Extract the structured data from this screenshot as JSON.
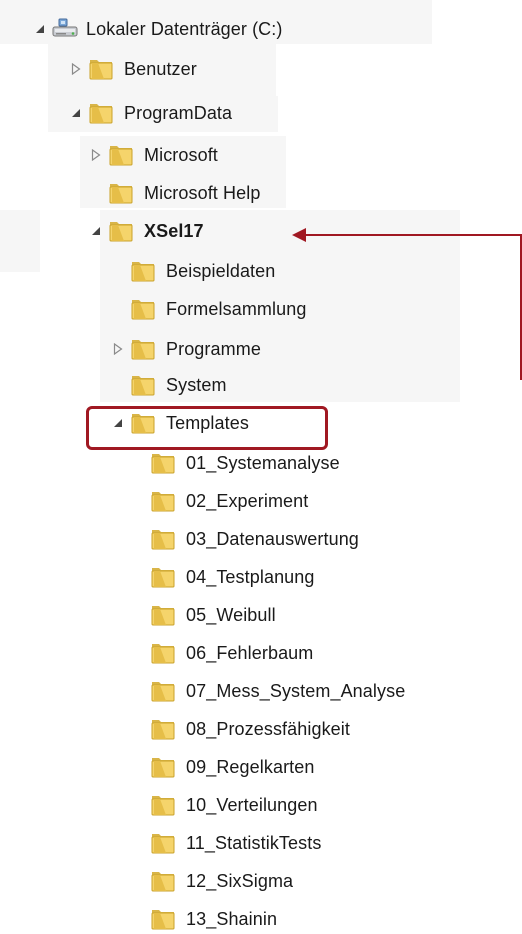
{
  "tree": {
    "root": {
      "label": "Lokaler Datenträger (C:)",
      "icon": "drive-icon",
      "toggle": "expanded"
    },
    "benutzer": {
      "label": "Benutzer",
      "toggle": "collapsed"
    },
    "programdata": {
      "label": "ProgramData",
      "toggle": "expanded"
    },
    "microsoft": {
      "label": "Microsoft",
      "toggle": "collapsed"
    },
    "microsoft_help": {
      "label": "Microsoft Help",
      "toggle": "none"
    },
    "xsel17": {
      "label": "XSel17",
      "toggle": "expanded"
    },
    "beispieldaten": {
      "label": "Beispieldaten",
      "toggle": "none"
    },
    "formelsammlung": {
      "label": "Formelsammlung",
      "toggle": "none"
    },
    "programme": {
      "label": "Programme",
      "toggle": "collapsed"
    },
    "system": {
      "label": "System",
      "toggle": "none"
    },
    "templates": {
      "label": "Templates",
      "toggle": "expanded"
    },
    "template_items": [
      "01_Systemanalyse",
      "02_Experiment",
      "03_Datenauswertung",
      "04_Testplanung",
      "05_Weibull",
      "06_Fehlerbaum",
      "07_Mess_System_Analyse",
      "08_Prozessfähigkeit",
      "09_Regelkarten",
      "10_Verteilungen",
      "11_StatistikTests",
      "12_SixSigma",
      "13_Shainin"
    ]
  },
  "colors": {
    "annotation": "#a01822",
    "folder_light": "#f3d26a",
    "folder_dark": "#c9a22b"
  }
}
